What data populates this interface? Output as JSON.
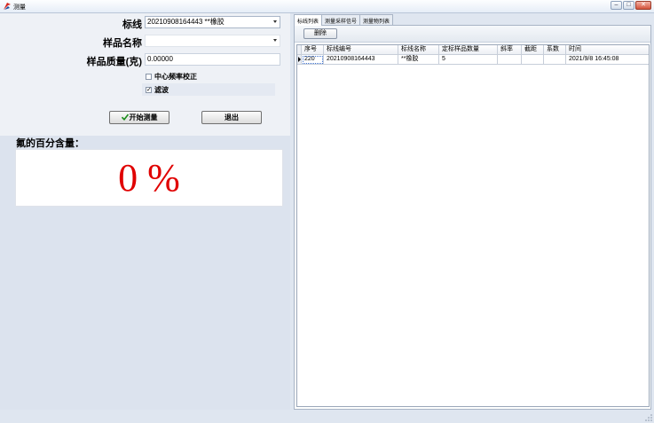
{
  "window": {
    "title": "测量",
    "buttons": {
      "minimize": "–",
      "maximize": "□",
      "close": "✕"
    }
  },
  "form": {
    "standard_line_label": "标线",
    "standard_line_value": "20210908164443 **橡胶",
    "sample_name_label": "样品名称",
    "sample_name_value": "",
    "sample_mass_label": "样品质量(克)",
    "sample_mass_value": "0.00000",
    "center_freq_label": "中心频率校正",
    "center_freq_checked": false,
    "filter_label": "滤波",
    "filter_checked": true,
    "start_button": "开始测量",
    "exit_button": "退出"
  },
  "result": {
    "label": "氟的百分含量：",
    "value": "0 %",
    "value_color": "#e00000"
  },
  "tabs": [
    {
      "label": "标线列表",
      "active": true
    },
    {
      "label": "测量采样信号",
      "active": false
    },
    {
      "label": "测量物列表",
      "active": false
    }
  ],
  "toolbar": {
    "delete_button": "删除"
  },
  "table": {
    "columns": [
      "序号",
      "标线编号",
      "标线名称",
      "定标样品数量",
      "斜率",
      "截距",
      "系数",
      "时间"
    ],
    "rows": [
      [
        "220",
        "20210908164443",
        "**橡胶",
        "5",
        "",
        "",
        "",
        "2021/9/8 16:45:08"
      ]
    ]
  },
  "icons": {
    "app": "app-logo-icon",
    "start": "checkmark-icon",
    "combo_arrow": "chevron-down-icon",
    "row_pointer": "row-pointer-icon"
  }
}
